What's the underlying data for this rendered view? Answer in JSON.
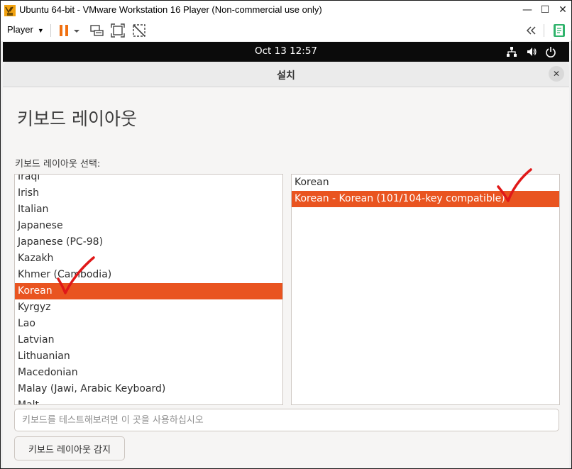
{
  "window": {
    "title": "Ubuntu 64-bit - VMware Workstation 16 Player (Non-commercial use only)",
    "minimize": "—",
    "maximize": "☐",
    "close": "✕"
  },
  "toolbar": {
    "player_label": "Player",
    "icons": [
      "pause-icon",
      "dropdown-icon",
      "send-ctrl-alt-del-icon",
      "fullscreen-icon",
      "unity-icon",
      "back-icon",
      "notes-icon"
    ]
  },
  "gnome": {
    "clock": "Oct 13  12:57",
    "icons": [
      "network-icon",
      "volume-icon",
      "power-icon"
    ]
  },
  "dialog": {
    "title": "설치",
    "close": "✕",
    "heading": "키보드 레이아웃",
    "select_label": "키보드 레이아웃 선택:",
    "layouts": [
      "Iraqi",
      "Irish",
      "Italian",
      "Japanese",
      "Japanese (PC-98)",
      "Kazakh",
      "Khmer (Cambodia)",
      "Korean",
      "Kyrgyz",
      "Lao",
      "Latvian",
      "Lithuanian",
      "Macedonian",
      "Malay (Jawi, Arabic Keyboard)",
      "Malt"
    ],
    "selected_layout_index": 7,
    "variants": [
      "Korean",
      "Korean - Korean (101/104-key compatible)"
    ],
    "selected_variant_index": 1,
    "test_placeholder": "키보드를 테스트해보려면 이 곳을 사용하십시오",
    "detect_button": "키보드 레이아웃 감지"
  },
  "colors": {
    "accent": "#e95420",
    "annotation": "#e01818"
  }
}
